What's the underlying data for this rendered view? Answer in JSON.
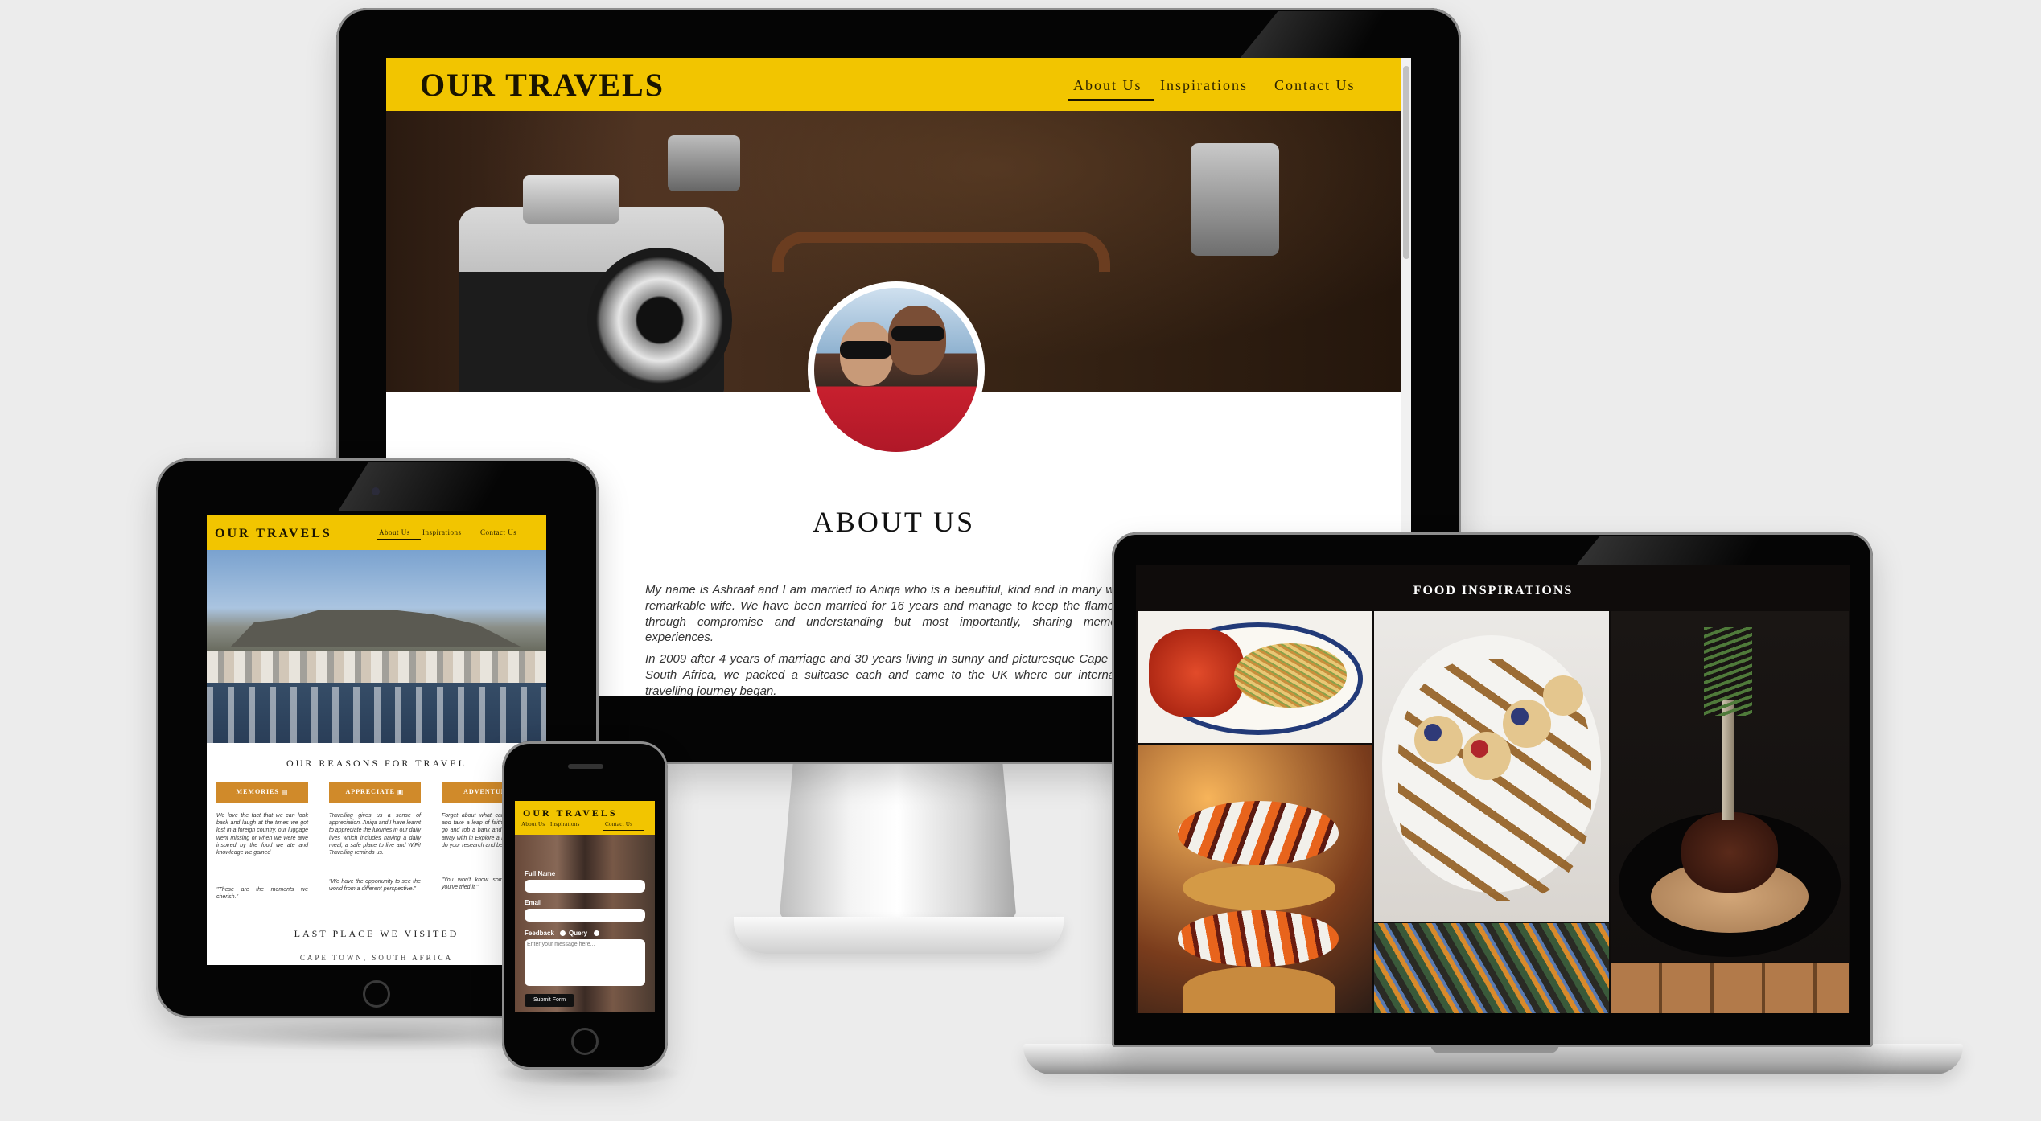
{
  "desktop": {
    "brand": "OUR TRAVELS",
    "nav": [
      "About Us",
      "Inspirations",
      "Contact Us"
    ],
    "active_nav": "About Us",
    "section_title": "ABOUT US",
    "paragraphs": [
      "My name is Ashraaf and I am married to Aniqa who is a beautiful, kind and in many ways a remarkable wife. We have been married for 16 years and manage to keep the flame alive through compromise and understanding but most importantly, sharing memorable experiences.",
      "In 2009 after 4 years of marriage and 30 years living in sunny and picturesque Cape Town, South Africa, we packed a suitcase each and came to the UK where our international travelling journey began."
    ]
  },
  "tablet": {
    "brand": "OUR TRAVELS",
    "nav": [
      "About Us",
      "Inspirations",
      "Contact Us"
    ],
    "reasons_title": "OUR REASONS FOR TRAVEL",
    "reasons": [
      {
        "label": "MEMORIES",
        "text": "We love the fact that we can look back and laugh at the times we got lost in a foreign country, our luggage went missing or when we were awe inspired by the food we ate and knowledge we gained",
        "quote": "\"These are the moments we cherish.\""
      },
      {
        "label": "APPRECIATE",
        "text": "Travelling gives us a sense of appreciation. Aniqa and I have learnt to appreciate the luxuries in our daily lives which includes having a daily meal, a safe place to live and WiFi! Travelling reminds us.",
        "quote": "\"We have the opportunity to see the world from a different perspective.\""
      },
      {
        "label": "ADVENTURE",
        "text": "Forget about what can go wrong and take a leap of faith. I don't say go and rob a bank and hope to get away with it! Explore a new country, do your research and be safe.",
        "quote": "\"You won't know something until you've tried it.\""
      }
    ],
    "last_place_title": "LAST PLACE WE VISITED",
    "last_place": "CAPE TOWN, SOUTH AFRICA"
  },
  "phone": {
    "brand": "OUR TRAVELS",
    "nav": [
      "About Us",
      "Inspirations",
      "Contact Us"
    ],
    "full_name_label": "Full Name",
    "email_label": "Email",
    "feedback_label": "Feedback",
    "query_label": "Query",
    "message_placeholder": "Enter your message here...",
    "submit_label": "Submit Form"
  },
  "laptop": {
    "title": "FOOD INSPIRATIONS"
  }
}
